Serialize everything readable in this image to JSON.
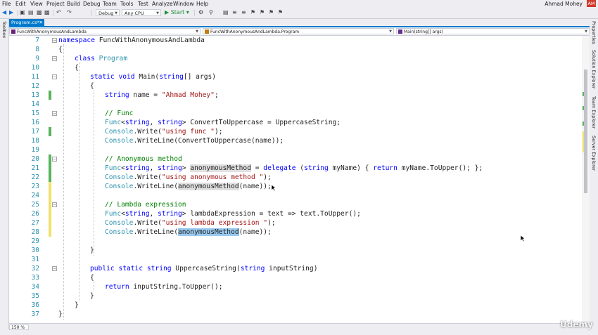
{
  "menu": [
    "File",
    "Edit",
    "View",
    "Project",
    "Build",
    "Debug",
    "Team",
    "Tools",
    "Test",
    "Analyze",
    "Window",
    "Help"
  ],
  "user": {
    "name": "Ahmad Mohey",
    "initials": "AM"
  },
  "toolbar": {
    "config": "Debug",
    "platform": "Any CPU",
    "start_label": "▶ Start ▾"
  },
  "sidebar_left": {
    "toolbox": "Toolbox"
  },
  "sidebar_right": [
    "Properties",
    "Solution Explorer",
    "Team Explorer",
    "Server Explorer"
  ],
  "tab": {
    "label": "Program.cs*",
    "close": "✕"
  },
  "nav": {
    "project": "FuncWithAnonymousAndLambda",
    "class": "FuncWithAnonymousAndLambda.Program",
    "member": "Main(string[] args)"
  },
  "zoom": "150 %",
  "watermark": "Udemy",
  "colors": {
    "accent": "#007acc",
    "keyword": "#0000ff",
    "type": "#2b91af",
    "string": "#a31515",
    "comment": "#008000",
    "saved_change": "#57b45b",
    "unsaved_change": "#efe26b"
  },
  "lines": [
    {
      "n": "7",
      "text": "namespace FuncWithAnonymousAndLambda"
    },
    {
      "n": "8",
      "text": "{"
    },
    {
      "n": "9",
      "text": "class Program"
    },
    {
      "n": "10",
      "text": "{"
    },
    {
      "n": "11",
      "text": "static void Main(string[] args)"
    },
    {
      "n": "12",
      "text": "{"
    },
    {
      "n": "13",
      "text": "string name = \"Ahmad Mohey\";"
    },
    {
      "n": "14",
      "text": ""
    },
    {
      "n": "15",
      "text": "// Func"
    },
    {
      "n": "16",
      "text": "Func<string, string> ConvertToUppercase = UppercaseString;"
    },
    {
      "n": "17",
      "text": "Console.Write(\"using func \");"
    },
    {
      "n": "18",
      "text": "Console.WriteLine(ConvertToUppercase(name));"
    },
    {
      "n": "19",
      "text": ""
    },
    {
      "n": "20",
      "text": "// Anonymous method"
    },
    {
      "n": "21",
      "text": "Func<string, string> anonymousMethod = delegate (string myName) { return myName.ToUpper(); };"
    },
    {
      "n": "22",
      "text": "Console.Write(\"using anonymous method \");"
    },
    {
      "n": "23",
      "text": "Console.WriteLine(anonymousMethod(name));"
    },
    {
      "n": "24",
      "text": ""
    },
    {
      "n": "25",
      "text": "// Lambda expression"
    },
    {
      "n": "26",
      "text": "Func<string, string> lambdaExpression = text => text.ToUpper();"
    },
    {
      "n": "27",
      "text": "Console.Write(\"using lambda expression \");"
    },
    {
      "n": "28",
      "text": "Console.WriteLine(anonymousMethod(name));"
    },
    {
      "n": "29",
      "text": ""
    },
    {
      "n": "30",
      "text": "}"
    },
    {
      "n": "31",
      "text": ""
    },
    {
      "n": "32",
      "text": "public static string UppercaseString(string inputString)"
    },
    {
      "n": "33",
      "text": "{"
    },
    {
      "n": "34",
      "text": "return inputString.ToUpper();"
    },
    {
      "n": "35",
      "text": "}"
    },
    {
      "n": "36",
      "text": "}"
    },
    {
      "n": "37",
      "text": "}"
    }
  ]
}
